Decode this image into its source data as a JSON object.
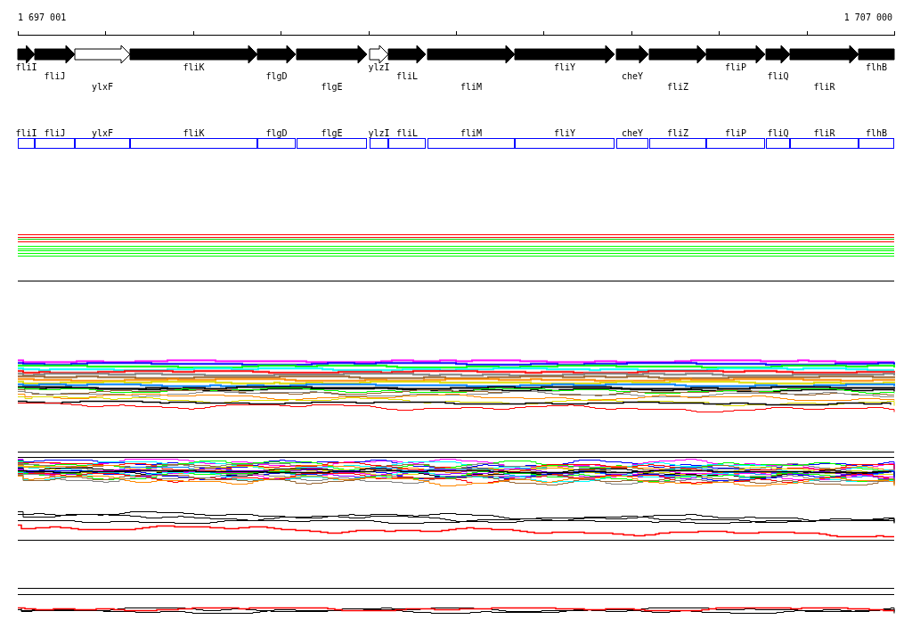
{
  "ruler": {
    "start_label": "1 697 001",
    "end_label": "1 707 000"
  },
  "genes": [
    {
      "label": "fliI",
      "kind": "filled"
    },
    {
      "label": "fliJ",
      "kind": "filled"
    },
    {
      "label": "ylxF",
      "kind": "hollow"
    },
    {
      "label": "fliK",
      "kind": "filled"
    },
    {
      "label": "flgD",
      "kind": "filled"
    },
    {
      "label": "flgE",
      "kind": "filled"
    },
    {
      "label": "ylzI",
      "kind": "hollow"
    },
    {
      "label": "fliL",
      "kind": "filled"
    },
    {
      "label": "fliM",
      "kind": "filled"
    },
    {
      "label": "fliY",
      "kind": "filled"
    },
    {
      "label": "cheY",
      "kind": "filled"
    },
    {
      "label": "fliZ",
      "kind": "filled"
    },
    {
      "label": "fliP",
      "kind": "filled"
    },
    {
      "label": "fliQ",
      "kind": "filled"
    },
    {
      "label": "fliR",
      "kind": "filled"
    },
    {
      "label": "flhB",
      "kind": "filled"
    }
  ],
  "gene_boxes": [
    {
      "label": "fliI"
    },
    {
      "label": "fliJ"
    },
    {
      "label": "ylxF"
    },
    {
      "label": "fliK"
    },
    {
      "label": "flgD"
    },
    {
      "label": "flgE"
    },
    {
      "label": "ylzI"
    },
    {
      "label": "fliL"
    },
    {
      "label": "fliM"
    },
    {
      "label": "fliY"
    },
    {
      "label": "cheY"
    },
    {
      "label": "fliZ"
    },
    {
      "label": "fliP"
    },
    {
      "label": "fliQ"
    },
    {
      "label": "fliR"
    },
    {
      "label": "flhB"
    }
  ]
}
